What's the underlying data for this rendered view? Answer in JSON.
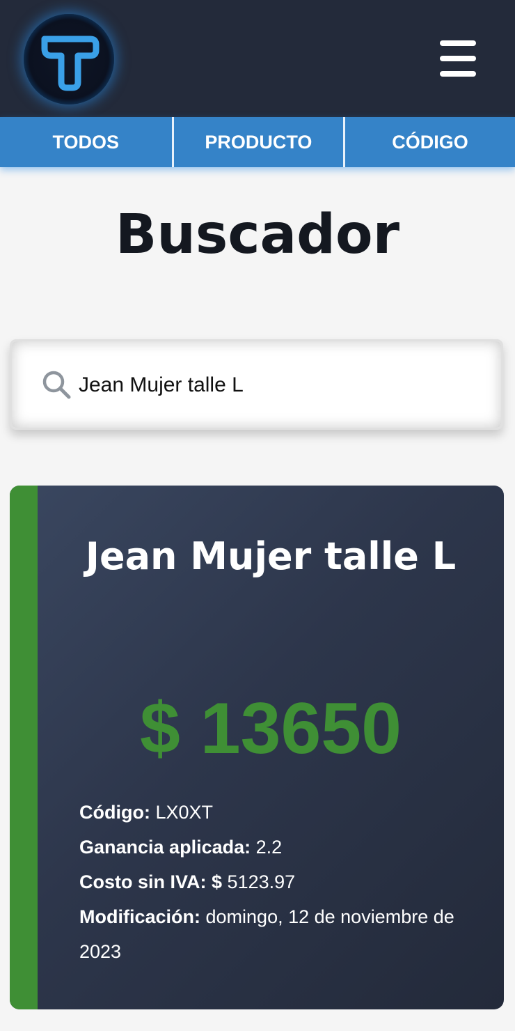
{
  "header": {
    "logo_icon": "t-letter-logo-icon",
    "menu_icon": "hamburger-menu-icon"
  },
  "tabs": [
    {
      "label": "TODOS"
    },
    {
      "label": "PRODUCTO"
    },
    {
      "label": "CÓDIGO"
    }
  ],
  "page": {
    "title": "Buscador"
  },
  "search": {
    "value": "Jean Mujer talle L",
    "icon": "search-icon"
  },
  "result": {
    "name": "Jean Mujer talle L",
    "price": "$ 13650",
    "code_label": "Código:",
    "code_value": "LX0XT",
    "margin_label": "Ganancia aplicada:",
    "margin_value": "2.2",
    "cost_label": "Costo sin IVA: $",
    "cost_value": "5123.97",
    "modified_label": "Modificación:",
    "modified_value": "domingo, 12 de noviembre de 2023"
  },
  "colors": {
    "header_bg": "#232a3a",
    "tab_bg": "#3583c8",
    "accent_green": "#3f8f35",
    "page_bg": "#f5f5f5"
  }
}
